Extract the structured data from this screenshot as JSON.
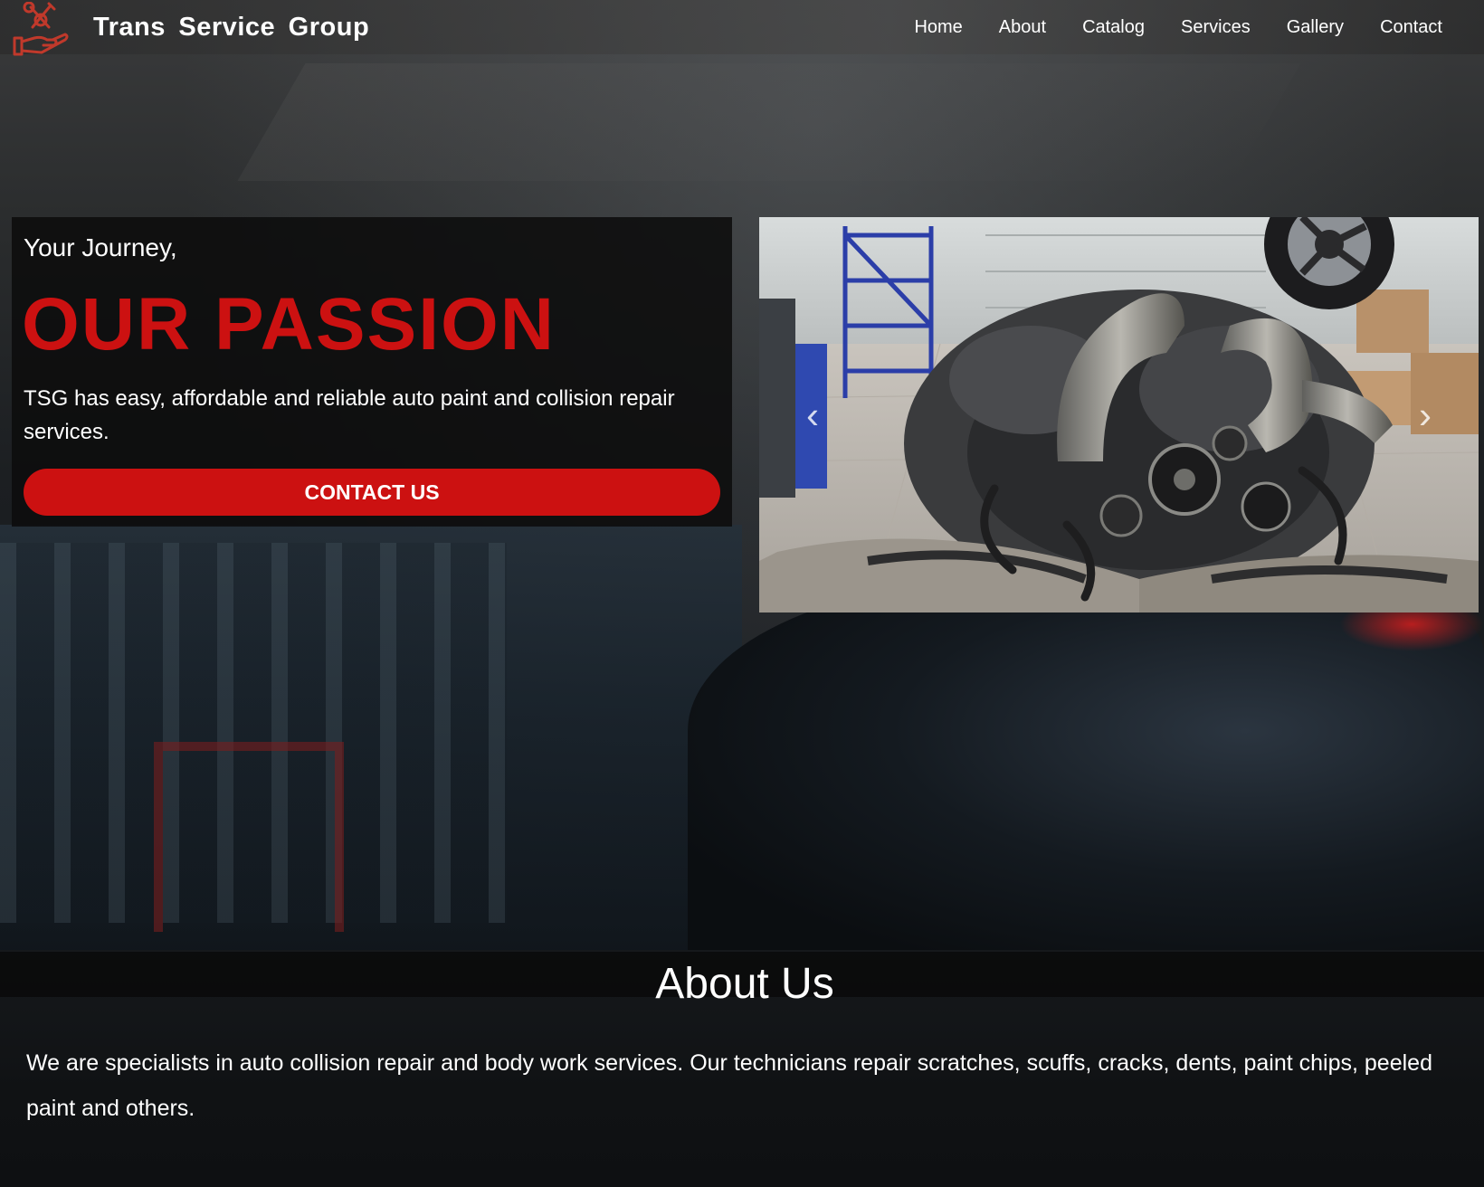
{
  "header": {
    "brand": "Trans Service Group",
    "logo_icon": "hand-wrench-icon",
    "nav": [
      {
        "label": "Home"
      },
      {
        "label": "About"
      },
      {
        "label": "Catalog"
      },
      {
        "label": "Services"
      },
      {
        "label": "Gallery"
      },
      {
        "label": "Contact"
      }
    ]
  },
  "hero": {
    "kicker": "Your Journey,",
    "title": "OUR PASSION",
    "text": "TSG has easy, affordable and reliable auto paint and collision repair services.",
    "cta_label": "CONTACT US",
    "carousel": {
      "prev_icon": "chevron-left-icon",
      "next_icon": "chevron-right-icon",
      "prev_glyph": "‹",
      "next_glyph": "›"
    }
  },
  "about": {
    "title": "About Us",
    "text": "We are specialists in auto collision repair and body work services. Our technicians repair scratches, scuffs, cracks, dents, paint chips, peeled paint and others."
  },
  "colors": {
    "accent": "#cc1111",
    "text": "#ffffff",
    "card_bg": "#0c0c0c"
  }
}
